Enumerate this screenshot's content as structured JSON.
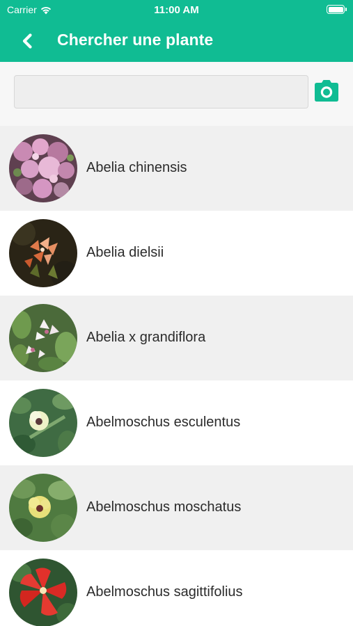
{
  "status_bar": {
    "carrier": "Carrier",
    "time": "11:00 AM",
    "icons": [
      "wifi-icon",
      "battery-icon"
    ]
  },
  "nav": {
    "title": "Chercher une plante",
    "back_icon": "chevron-left-icon"
  },
  "search": {
    "value": "",
    "placeholder": "",
    "camera_icon": "camera-icon"
  },
  "colors": {
    "accent": "#10bc93",
    "row_shaded": "#f0f0f0",
    "row_plain": "#ffffff"
  },
  "plants": [
    {
      "name": "Abelia chinensis"
    },
    {
      "name": "Abelia dielsii"
    },
    {
      "name": "Abelia x grandiflora"
    },
    {
      "name": "Abelmoschus esculentus"
    },
    {
      "name": "Abelmoschus moschatus"
    },
    {
      "name": "Abelmoschus sagittifolius"
    }
  ]
}
